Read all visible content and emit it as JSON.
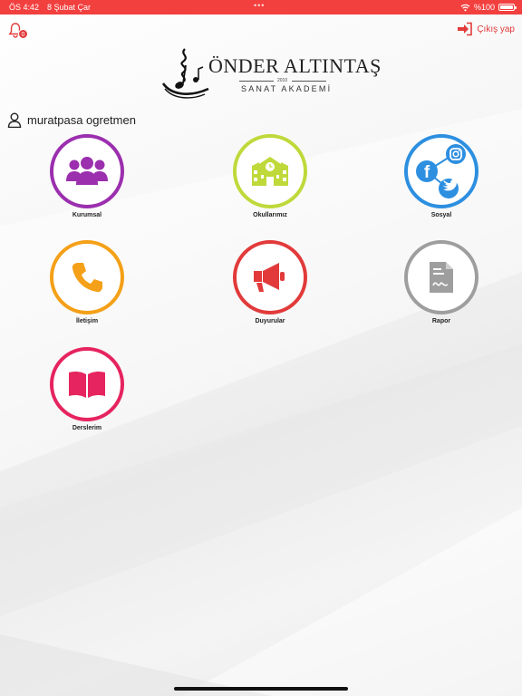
{
  "status_bar": {
    "time": "ÖS 4:42",
    "date": "8 Şubat Çar",
    "battery": "%100",
    "battery_level": 1.0
  },
  "header": {
    "notification_count": "0",
    "logout_label": "Çıkış yap"
  },
  "logo": {
    "brand": "ÖNDER ALTINTAŞ",
    "year": "2010",
    "subtitle": "SANAT AKADEMİ"
  },
  "user": {
    "name": "muratpasa ogretmen"
  },
  "menu": {
    "items": [
      {
        "label": "Kurumsal",
        "icon": "group-icon",
        "color": "#9b2fae"
      },
      {
        "label": "Okullarımız",
        "icon": "school-building-icon",
        "color": "#bfd93a"
      },
      {
        "label": "Sosyal",
        "icon": "social-share-icon",
        "color": "#2d8fe0"
      },
      {
        "label": "İletişim",
        "icon": "phone-icon",
        "color": "#f4a018"
      },
      {
        "label": "Duyurular",
        "icon": "megaphone-icon",
        "color": "#e23a3a"
      },
      {
        "label": "Rapor",
        "icon": "report-document-icon",
        "color": "#9e9e9e"
      },
      {
        "label": "Derslerim",
        "icon": "open-book-icon",
        "color": "#e6245f"
      }
    ]
  },
  "colors": {
    "accent": "#f2403f",
    "logout": "#e23a3a"
  }
}
